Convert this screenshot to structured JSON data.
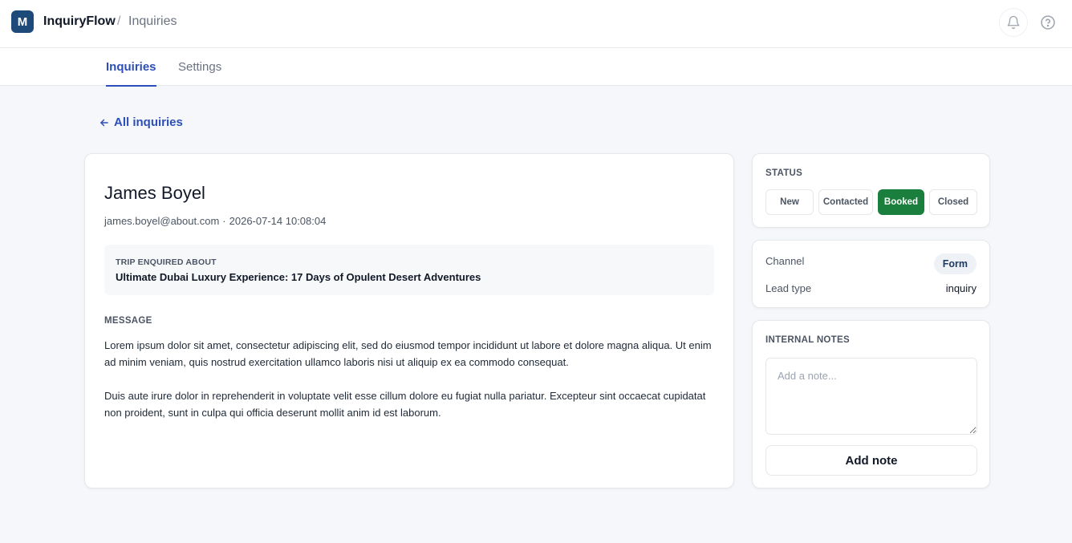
{
  "app": {
    "logo_letter": "M",
    "brand": "InquiryFlow",
    "breadcrumb_separator": "/",
    "breadcrumb_current": "Inquiries"
  },
  "header_icons": {
    "notifications": "bell-icon",
    "help": "question-circle-icon"
  },
  "tabs": [
    {
      "label": "Inquiries",
      "active": true
    },
    {
      "label": "Settings",
      "active": false
    }
  ],
  "back_link": {
    "label": "All inquiries",
    "icon": "arrow-left-icon"
  },
  "inquiry": {
    "name": "James Boyel",
    "email": "james.boyel@about.com",
    "meta_separator": "·",
    "timestamp": "2026-07-14 10:08:04",
    "trip_label": "TRIP ENQUIRED ABOUT",
    "trip_title": "Ultimate Dubai Luxury Experience: 17 Days of Opulent Desert Adventures",
    "message_label": "MESSAGE",
    "message_paragraphs": [
      "Lorem ipsum dolor sit amet, consectetur adipiscing elit, sed do eiusmod tempor incididunt ut labore et dolore magna aliqua. Ut enim ad minim veniam, quis nostrud exercitation ullamco laboris nisi ut aliquip ex ea commodo consequat.",
      "Duis aute irure dolor in reprehenderit in voluptate velit esse cillum dolore eu fugiat nulla pariatur. Excepteur sint occaecat cupidatat non proident, sunt in culpa qui officia deserunt mollit anim id est laborum."
    ]
  },
  "status": {
    "label": "STATUS",
    "options": [
      "New",
      "Contacted",
      "Booked",
      "Closed"
    ],
    "selected": "Booked"
  },
  "details": {
    "channel_label": "Channel",
    "channel_value": "Form",
    "lead_type_label": "Lead type",
    "lead_type_value": "inquiry"
  },
  "notes": {
    "label": "INTERNAL NOTES",
    "placeholder": "Add a note...",
    "value": "",
    "add_button": "Add note"
  },
  "colors": {
    "accent": "#2d4fb8",
    "logo_bg": "#1e4a7a",
    "booked_green": "#1a7f3c",
    "page_bg": "#f5f7fa"
  }
}
